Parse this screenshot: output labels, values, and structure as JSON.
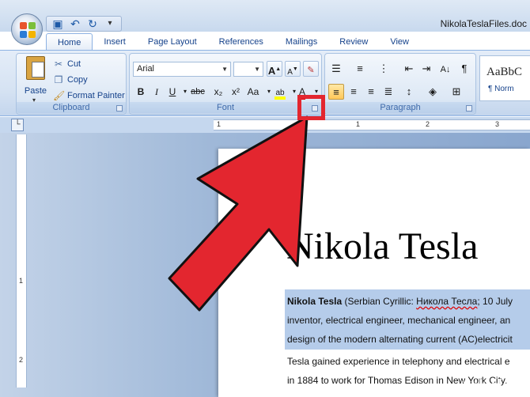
{
  "window": {
    "title": "NikolaTeslaFiles.doc"
  },
  "quick_access": {
    "save_icon": "save-icon",
    "undo_icon": "undo-icon",
    "redo_icon": "redo-icon",
    "customize": "▾"
  },
  "tabs": [
    {
      "label": "Home",
      "active": true
    },
    {
      "label": "Insert"
    },
    {
      "label": "Page Layout"
    },
    {
      "label": "References"
    },
    {
      "label": "Mailings"
    },
    {
      "label": "Review"
    },
    {
      "label": "View"
    }
  ],
  "clipboard": {
    "paste_label": "Paste",
    "cut_label": "Cut",
    "copy_label": "Copy",
    "format_painter_label": "Format Painter",
    "group_label": "Clipboard"
  },
  "font": {
    "family": "Arial",
    "size": "",
    "group_label": "Font",
    "bold": "B",
    "italic": "I",
    "underline": "U",
    "strikethrough": "abc",
    "subscript": "x₂",
    "superscript": "x²",
    "change_case": "Aa",
    "grow": "A",
    "shrink": "A",
    "font_color": "A"
  },
  "paragraph": {
    "group_label": "Paragraph"
  },
  "styles": {
    "sample": "AaBbC",
    "name": "¶ Norm"
  },
  "ruler": {
    "h_numbers": [
      "1",
      "1",
      "2",
      "3"
    ],
    "v_numbers": [
      "1",
      "2"
    ]
  },
  "document": {
    "heading": "Nikola Tesla",
    "lines": [
      {
        "bold": "Nikola Tesla",
        "rest1": " (Serbian Cyrillic: ",
        "cyr": "Никола Тесла",
        "rest2": "; 10 July"
      },
      {
        "text": "inventor, electrical engineer, mechanical engineer, an"
      },
      {
        "text": "design of the modern alternating current (AC)electricit"
      },
      {
        "text": "Tesla gained experience in telephony and electrical e"
      },
      {
        "text": "in 1884 to work for Thomas Edison in New York City."
      }
    ]
  },
  "watermark": {
    "wiki": "wiki",
    "how": "How"
  },
  "colors": {
    "annotation_red": "#e3262f",
    "ribbon_blue": "#d6e3f3",
    "selection": "#b5ccea"
  }
}
